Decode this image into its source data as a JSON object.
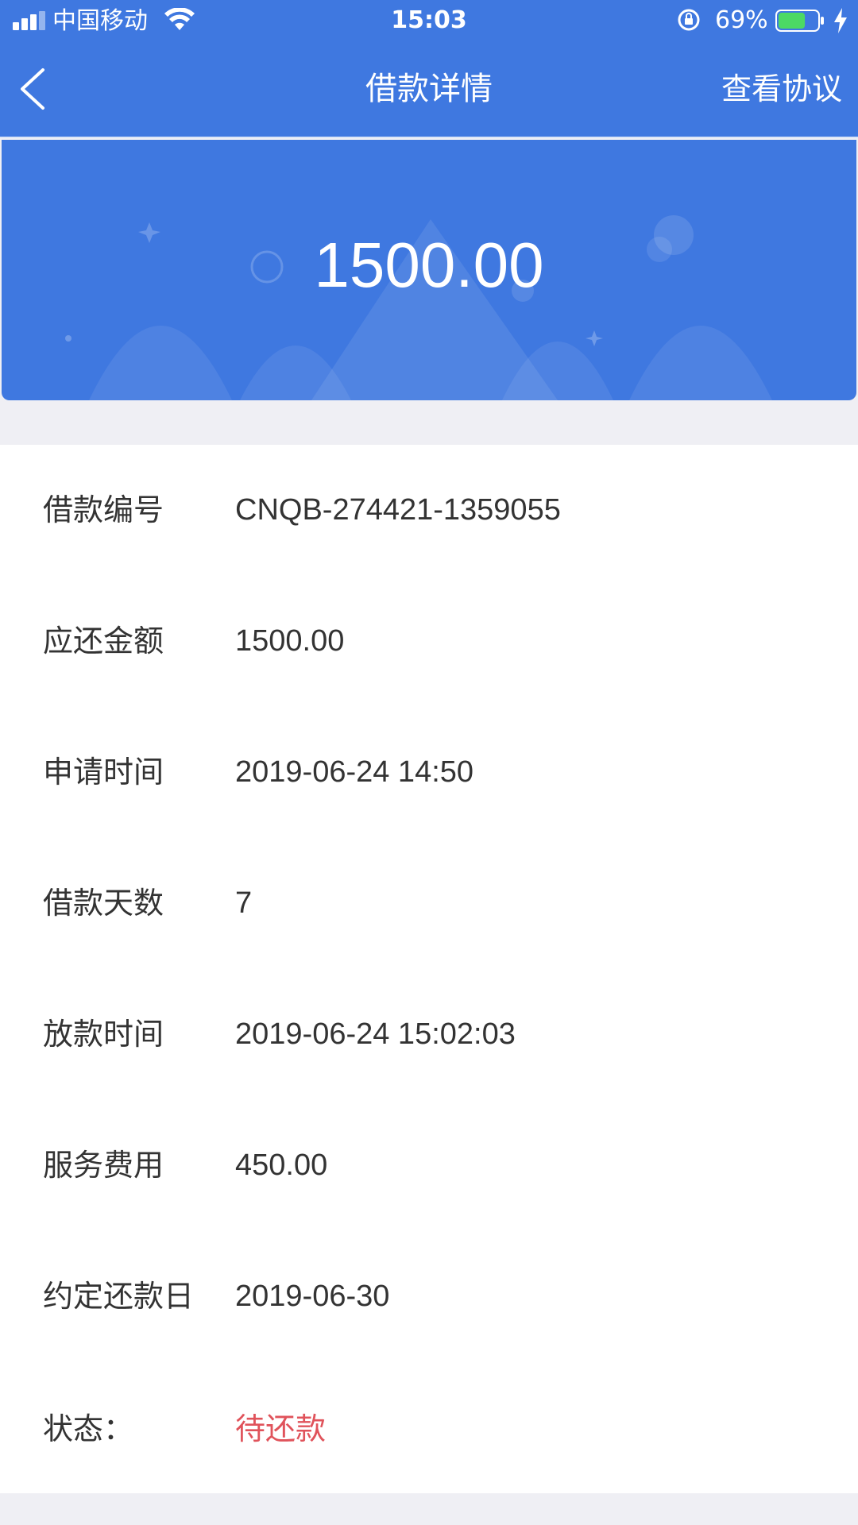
{
  "status_bar": {
    "carrier": "中国移动",
    "time": "15:03",
    "battery_percent": "69%",
    "battery_level": 0.69,
    "signal_icon": "signal-bars-icon",
    "wifi_icon": "wifi-icon",
    "lock_icon": "rotation-lock-icon",
    "battery_icon": "battery-icon",
    "charging_icon": "charging-bolt-icon"
  },
  "nav": {
    "back_icon": "chevron-left-icon",
    "title": "借款详情",
    "right_action": "查看协议"
  },
  "hero": {
    "amount": "1500.00"
  },
  "details": {
    "rows": [
      {
        "label": "借款编号",
        "value": "CNQB-274421-1359055"
      },
      {
        "label": "应还金额",
        "value": "1500.00"
      },
      {
        "label": "申请时间",
        "value": "2019-06-24 14:50"
      },
      {
        "label": "借款天数",
        "value": "7"
      },
      {
        "label": "放款时间",
        "value": "2019-06-24 15:02:03"
      },
      {
        "label": "服务费用",
        "value": "450.00"
      },
      {
        "label": "约定还款日",
        "value": "2019-06-30"
      },
      {
        "label": "状态：",
        "value": "待还款"
      }
    ]
  },
  "colors": {
    "primary_blue": "#3f78e0",
    "status_red": "#e0535b",
    "text_dark": "#333333",
    "page_bg": "#efeff4"
  }
}
